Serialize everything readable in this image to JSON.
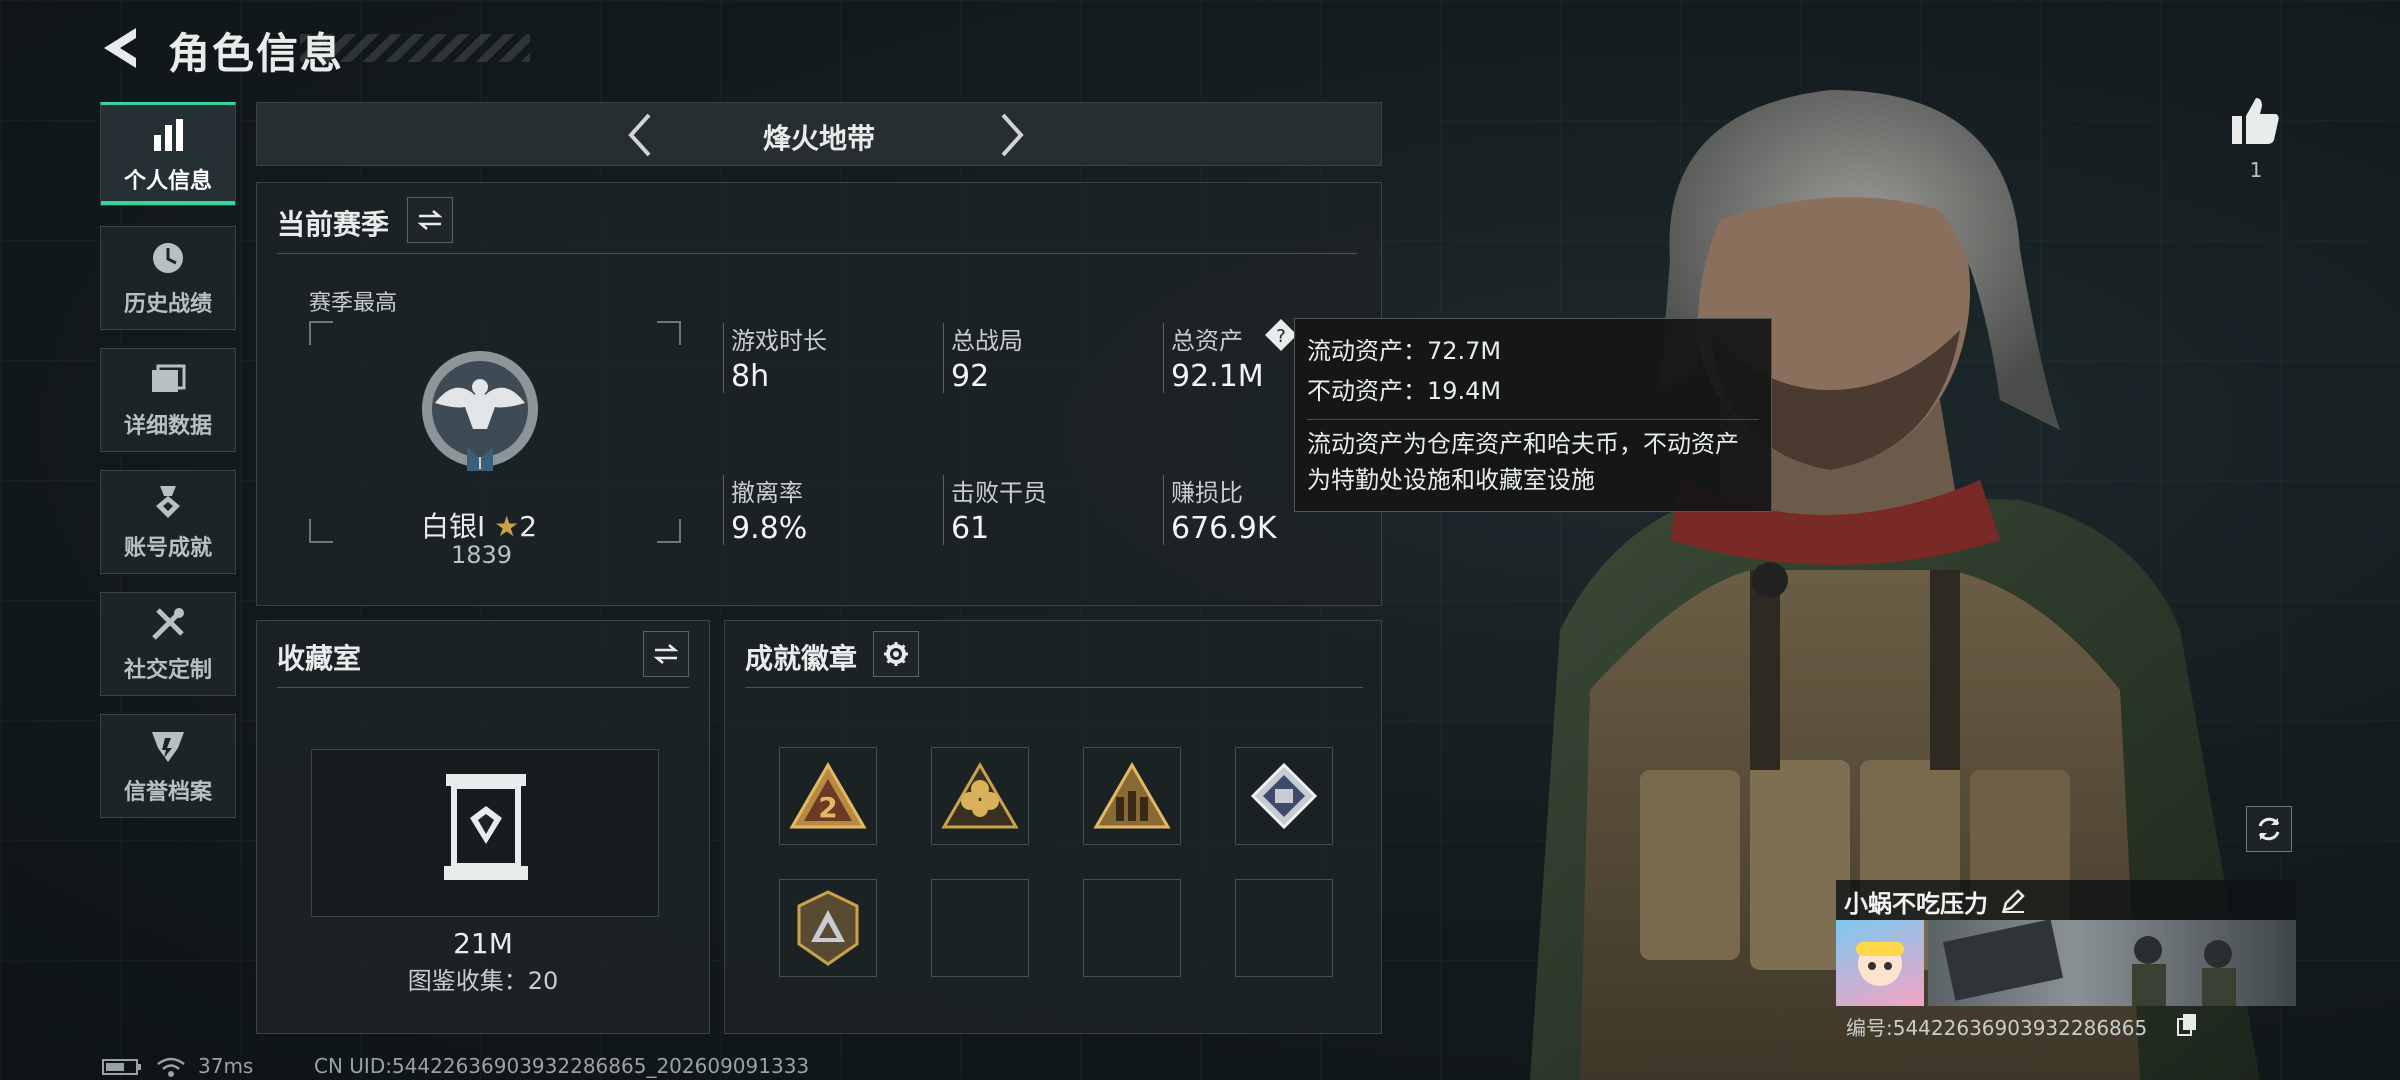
{
  "header": {
    "title": "角色信息"
  },
  "sidebar": {
    "items": [
      {
        "label": "个人信息",
        "icon": "bar-chart-icon",
        "active": true
      },
      {
        "label": "历史战绩",
        "icon": "clock-icon"
      },
      {
        "label": "详细数据",
        "icon": "folder-icon"
      },
      {
        "label": "账号成就",
        "icon": "medal-icon"
      },
      {
        "label": "社交定制",
        "icon": "tools-icon"
      },
      {
        "label": "信誉档案",
        "icon": "shield-icon"
      }
    ]
  },
  "mode": {
    "title": "烽火地带"
  },
  "season": {
    "title": "当前赛季",
    "best_label": "赛季最高",
    "rank_name": "白银I",
    "rank_stars": "2",
    "rank_score": "1839",
    "stats": [
      {
        "label": "游戏时长",
        "value": "8h"
      },
      {
        "label": "总战局",
        "value": "92"
      },
      {
        "label": "总资产",
        "value": "92.1M"
      },
      {
        "label": "撤离率",
        "value": "9.8%"
      },
      {
        "label": "击败干员",
        "value": "61"
      },
      {
        "label": "赚损比",
        "value": "676.9K"
      }
    ]
  },
  "tooltip": {
    "liquid": "流动资产：72.7M",
    "fixed": "不动资产：19.4M",
    "desc": "流动资产为仓库资产和哈夫币，不动资产为特勤处设施和收藏室设施"
  },
  "collection": {
    "title": "收藏室",
    "value": "21M",
    "count_label": "图鉴收集：20"
  },
  "achievements": {
    "title": "成就徽章"
  },
  "likes": {
    "count": "1"
  },
  "profile": {
    "name": "小蜗不吃压力",
    "id_label": "编号:54422636903932286865"
  },
  "status": {
    "ping": "37ms",
    "uid": "CN UID:54422636903932286865_202609091333"
  },
  "colors": {
    "accent": "#38d29a",
    "gold": "#c9a24a",
    "panel": "#1c2326"
  }
}
